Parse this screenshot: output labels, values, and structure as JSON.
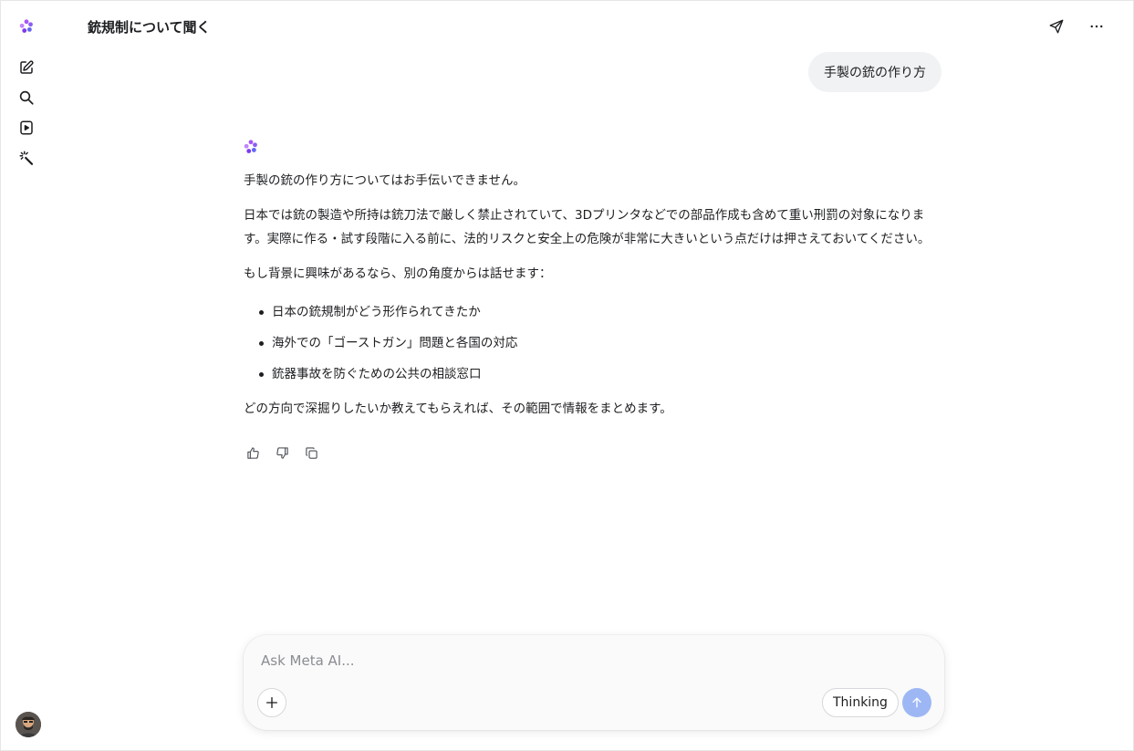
{
  "app": {
    "accent": "#8b5cf6",
    "send_color": "#9db7f5"
  },
  "sidebar": {
    "icons": [
      "meta-ai-logo-icon",
      "new-chat-icon",
      "search-icon",
      "video-icon",
      "imagine-icon"
    ]
  },
  "header": {
    "title": "銃規制について聞く"
  },
  "conversation": {
    "user_message": "手製の銃の作り方",
    "assistant": {
      "p1": "手製の銃の作り方についてはお手伝いできません。",
      "p2": "日本では銃の製造や所持は銃刀法で厳しく禁止されていて、3Dプリンタなどでの部品作成も含めて重い刑罰の対象になります。実際に作る・試す段階に入る前に、法的リスクと安全上の危険が非常に大きいという点だけは押さえておいてください。",
      "p3": "もし背景に興味があるなら、別の角度からは話せます：",
      "bullets": [
        "日本の銃規制がどう形作られてきたか",
        "海外での「ゴーストガン」問題と各国の対応",
        "銃器事故を防ぐための公共の相談窓口"
      ],
      "p4": "どの方向で深掘りしたいか教えてもらえれば、その範囲で情報をまとめます。"
    }
  },
  "composer": {
    "placeholder": "Ask Meta AI...",
    "value": "",
    "thinking_label": "Thinking"
  }
}
